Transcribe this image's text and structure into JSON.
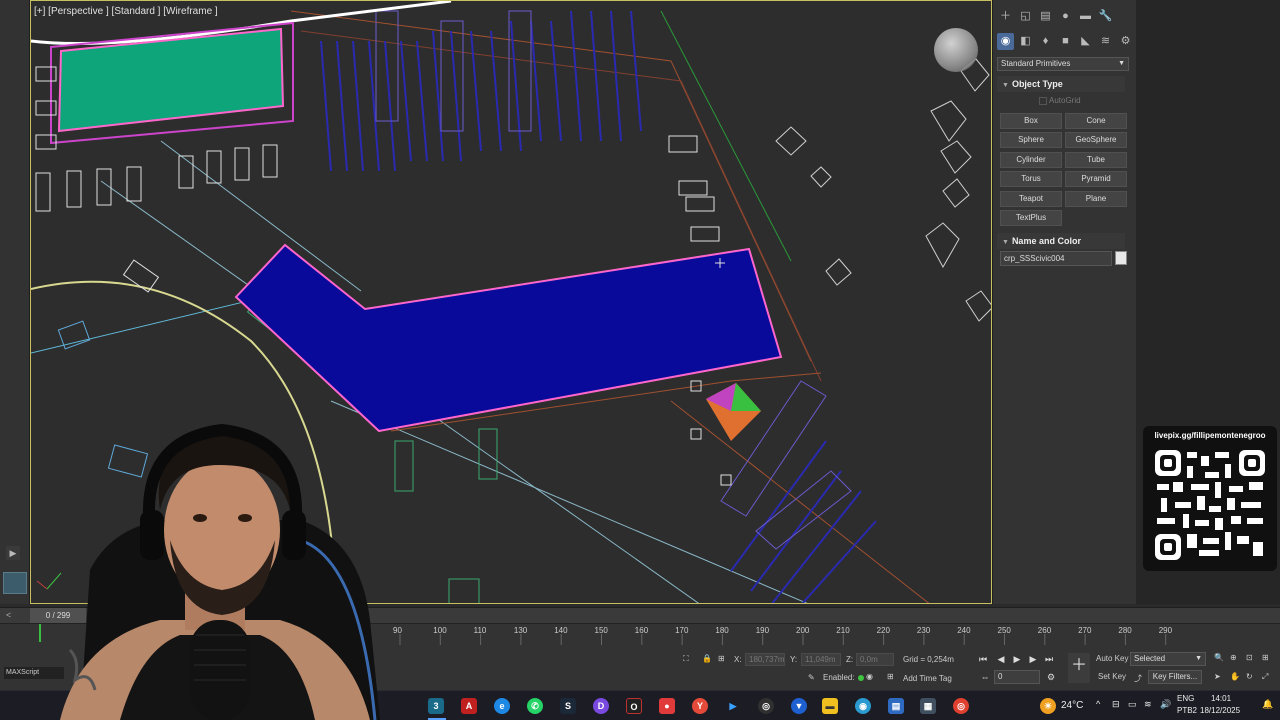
{
  "viewport": {
    "label": "[+] [Perspective ] [Standard ] [Wireframe ]"
  },
  "command_panel": {
    "category": "Standard Primitives",
    "object_type": {
      "title": "Object Type",
      "autogrid": "AutoGrid",
      "buttons": [
        "Box",
        "Cone",
        "Sphere",
        "GeoSphere",
        "Cylinder",
        "Tube",
        "Torus",
        "Pyramid",
        "Teapot",
        "Plane",
        "TextPlus"
      ]
    },
    "name_and_color": {
      "title": "Name and Color",
      "name": "crp_SSScivic004",
      "color": "#e8e8e8"
    }
  },
  "overlay": {
    "qr_url": "livepix.gg/fillipemontenegroo"
  },
  "timeline": {
    "frame_counter": "0 / 299",
    "ticks": [
      "90",
      "100",
      "110",
      "130",
      "140",
      "150",
      "160",
      "170",
      "180",
      "190",
      "200",
      "210",
      "220",
      "230",
      "240",
      "250",
      "260",
      "270",
      "280",
      "290"
    ]
  },
  "status": {
    "x_label": "X:",
    "x_value": "180,737m",
    "y_label": "Y:",
    "y_value": "11,049m",
    "z_label": "Z:",
    "z_value": "0,0m",
    "grid": "Grid = 0,254m",
    "enabled": "Enabled:",
    "add_time_tag": "Add Time Tag",
    "auto_key": "Auto Key",
    "set_key": "Set Key",
    "selected": "Selected",
    "key_filters": "Key Filters...",
    "current_frame": "0"
  },
  "webcam": {
    "tag": "MAXScript"
  },
  "taskbar": {
    "weather": "24°C",
    "language": "ENG",
    "language_sub": "PTB2",
    "time": "14:01",
    "date": "18/12/2025"
  },
  "colors": {
    "selected_building": "#0a0a9a",
    "selected_outline": "#ff66cc",
    "green_roof": "#0fa57a",
    "viewport_border": "#c8c060"
  }
}
